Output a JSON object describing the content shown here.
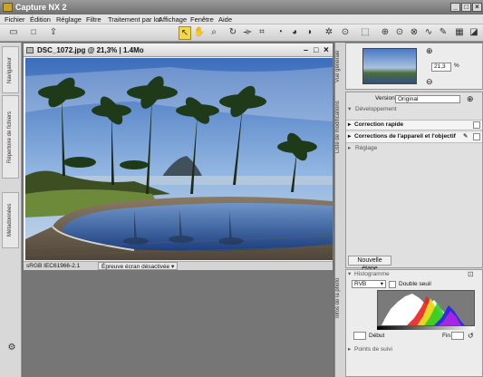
{
  "app": {
    "title": "Capture NX 2"
  },
  "menu": [
    "Fichier",
    "Édition",
    "Réglage",
    "Filtre",
    "Traitement par lot",
    "Affichage",
    "Fenêtre",
    "Aide"
  ],
  "document": {
    "title": "DSC_1072.jpg @ 21,3% | 1.4Mo",
    "profile": "sRGB IEC61966-2.1",
    "proof": "Épreuve écran désactivée"
  },
  "left_tabs": {
    "navigator": "Navigateur",
    "folders": "Répertoire de fichiers",
    "metadata": "Métadonnées"
  },
  "panels": {
    "overview_label": "Vue générale",
    "zoom": "21,3",
    "zoom_unit": "%",
    "edit_list_label": "Liste de modifications",
    "version_label": "Version",
    "version_value": "Original",
    "development": "Développement",
    "quick_fix": "Correction rapide",
    "camera_lens": "Corrections de l'appareil et l'objectif",
    "adjust": "Réglage",
    "new_step": "Nouvelle étape",
    "photo_info_label": "Infos de la photo",
    "histogram": "Histogramme",
    "channel": "RVB",
    "double_threshold": "Double seuil",
    "start": "Début",
    "end": "Fin",
    "watch_points": "Points de suivi"
  },
  "colors": {
    "accent_selected": "#f3d84b"
  }
}
